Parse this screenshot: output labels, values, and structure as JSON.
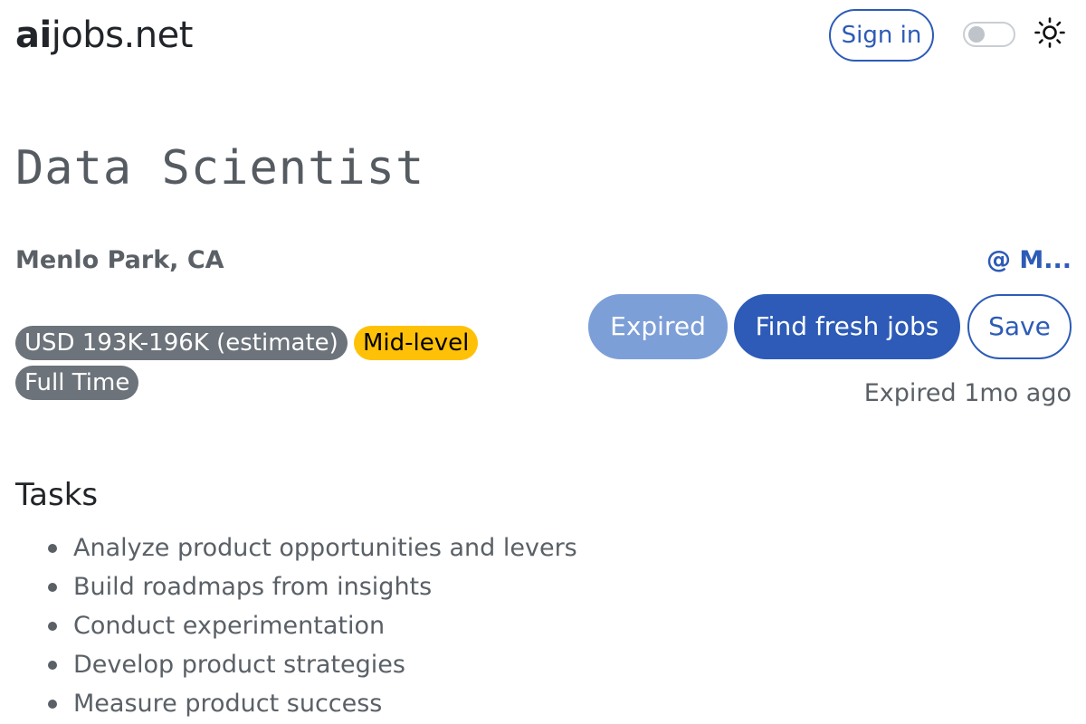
{
  "header": {
    "logo_bold": "ai",
    "logo_rest": "jobs.net",
    "sign_in_label": "Sign in",
    "theme_toggle": "off",
    "theme_icon": "sun-icon"
  },
  "job": {
    "title": "Data Scientist",
    "location": "Menlo Park, CA",
    "company": "@ M...",
    "badges": {
      "salary": "USD 193K-196K (estimate)",
      "level": "Mid-level",
      "employment_type": "Full Time"
    },
    "actions": {
      "expired_label": "Expired",
      "find_fresh_label": "Find fresh jobs",
      "save_label": "Save"
    },
    "expired_note": "Expired 1mo ago"
  },
  "tasks": {
    "heading": "Tasks",
    "items": [
      "Analyze product opportunities and levers",
      "Build roadmaps from insights",
      "Conduct experimentation",
      "Develop product strategies",
      "Measure product success"
    ]
  },
  "colors": {
    "accent": "#2d5bb7",
    "accent_light": "#7d9fd8",
    "badge_gray": "#6c737a",
    "badge_yellow": "#ffc107"
  }
}
